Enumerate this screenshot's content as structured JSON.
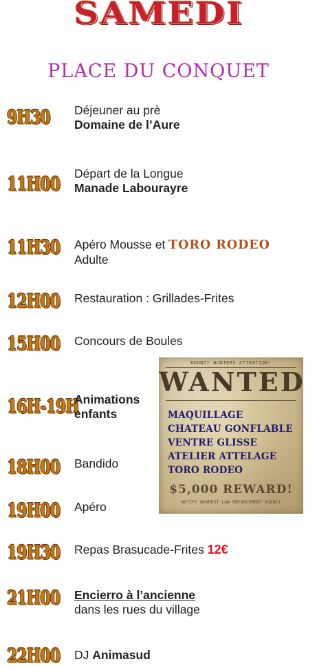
{
  "title": "SAMEDI",
  "subtitle": "PLACE DU CONQUET",
  "schedule": [
    {
      "time": "9H30",
      "line1": "Déjeuner au prè",
      "line2": "Domaine de l’Aure"
    },
    {
      "time": "11H00",
      "line1": "Départ de la Longue",
      "line2": "Manade Labourayre"
    },
    {
      "time": "11H30",
      "line1_prefix": "Apéro Mousse et ",
      "line1_highlight": "TORO RODEO",
      "line2": "Adulte"
    },
    {
      "time": "12H00",
      "line1": "Restauration : Grillades-Frites"
    },
    {
      "time": "15H00",
      "line1": "Concours de Boules"
    },
    {
      "time": "16H-19H",
      "line1": "Animations",
      "line2": "enfants"
    },
    {
      "time": "18H00",
      "line1": "Bandido"
    },
    {
      "time": "19H00",
      "line1": "Apéro"
    },
    {
      "time": "19H30",
      "line1_prefix": "Repas Brasucade-Frites ",
      "price": "12€"
    },
    {
      "time": "21H00",
      "line1": "Encierro à l’ancienne",
      "line2": "dans les rues du village"
    },
    {
      "time": "22H00",
      "line1_prefix": "DJ ",
      "line1_bold": "Animasud"
    }
  ],
  "wanted_poster": {
    "header": "BOUNTY HUNTERS ATTENTION!",
    "title": "WANTED",
    "items": [
      "MAQUILLAGE",
      "CHATEAU GONFLABLE",
      "VENTRE GLISSE",
      "ATELIER ATTELAGE",
      "TORO RODEO"
    ],
    "reward": "$5,000 REWARD!",
    "footer": "NOTIFY NEAREST LAW ENFORCEMENT AGENCY"
  },
  "colors": {
    "title": "#c8202a",
    "subtitle": "#b52ca8",
    "time": "#c47a19",
    "toro_rodeo": "#b2521c",
    "price": "#e1141b",
    "poster_text": "#1f1a6e",
    "poster_paper": "#e9dcb2"
  }
}
